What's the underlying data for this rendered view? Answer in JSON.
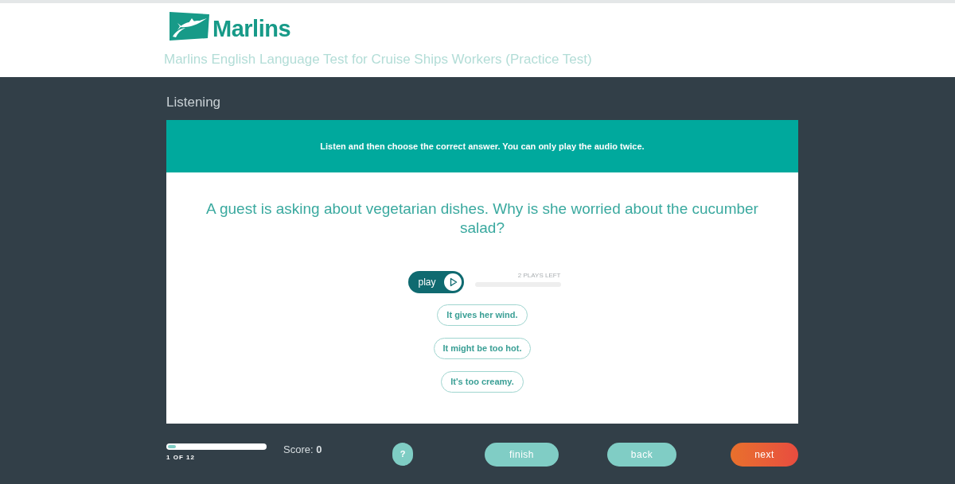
{
  "header": {
    "logo_text": "Marlins",
    "subtitle": "Marlins English Language Test for Cruise Ships Workers (Practice Test)"
  },
  "section_title": "Listening",
  "card": {
    "instruction": "Listen and then choose the correct answer. You can only play the audio twice.",
    "question": "A guest is asking about vegetarian dishes. Why is she worried about the cucumber salad?",
    "audio": {
      "play_label": "play",
      "plays_left": "2 PLAYS LEFT"
    },
    "answers": [
      {
        "label": "It gives her wind.",
        "selected": false
      },
      {
        "label": "It might be too hot.",
        "selected": false
      },
      {
        "label": "It's too creamy.",
        "selected": false
      }
    ]
  },
  "footer": {
    "progress": {
      "level": 0.08,
      "label": "1 OF 12"
    },
    "score": "Score: **0**",
    "help": "?",
    "buttons": [
      {
        "label": "finish",
        "kind": "secondary"
      },
      {
        "label": "back",
        "kind": "secondary"
      },
      {
        "label": "next",
        "kind": "primary"
      }
    ]
  }
}
